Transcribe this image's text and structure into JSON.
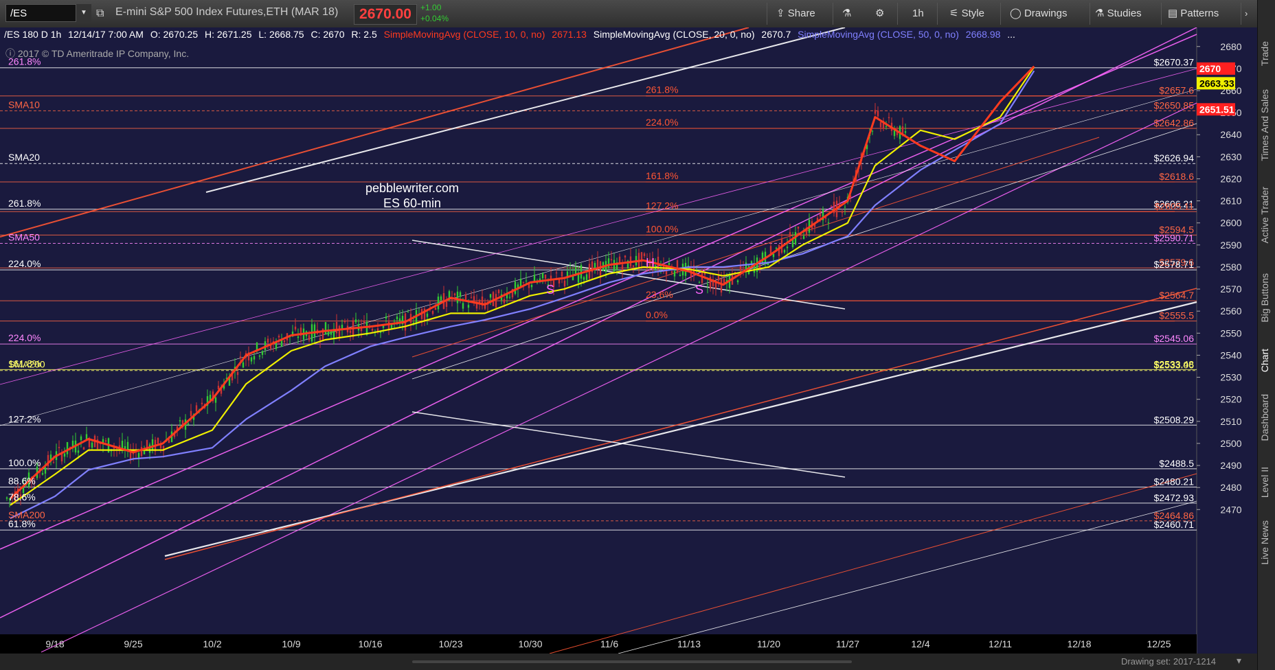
{
  "toolbar": {
    "symbol": "/ES",
    "instrument": "E-mini S&P 500 Index Futures,ETH (MAR 18)",
    "last_price": "2670.00",
    "change": "+1.00",
    "change_pct": "+0.04%",
    "share_label": "Share",
    "timeframe": "1h",
    "style_label": "Style",
    "drawings_label": "Drawings",
    "studies_label": "Studies",
    "patterns_label": "Patterns"
  },
  "infobar": {
    "desc": "/ES 180 D 1h",
    "date": "12/14/17 7:00 AM",
    "open": "O: 2670.25",
    "high": "H: 2671.25",
    "low": "L: 2668.75",
    "close": "C: 2670",
    "range": "R: 2.5",
    "sma10_label": "SimpleMovingAvg (CLOSE, 10, 0, no)",
    "sma10_val": "2671.13",
    "sma20_label": "SimpleMovingAvg (CLOSE, 20, 0, no)",
    "sma20_val": "2670.7",
    "sma50_label": "SimpleMovingAvg (CLOSE, 50, 0, no)",
    "sma50_val": "2668.98",
    "more": "..."
  },
  "copyright": "2017 © TD Ameritrade IP Company, Inc.",
  "side_tabs": [
    "Trade",
    "Times And Sales",
    "Active Trader",
    "Big Buttons",
    "Chart",
    "Dashboard",
    "Level II",
    "Live News"
  ],
  "status": {
    "drawing_set": "Drawing set: 2017-1214"
  },
  "watermark": [
    "pebblewriter.com",
    "ES 60-min"
  ],
  "colors": {
    "background": "#1a1a3e",
    "sma10": "#ff3b1f",
    "sma20": "#f0f000",
    "sma50": "#8080ff",
    "fib_red": "#ff5533",
    "fib_magenta": "#ff66ff",
    "price_up": "#33cc33",
    "price_down": "#cc3333"
  },
  "chart_data": {
    "type": "line",
    "title": "/ES 180 D 1h",
    "ylim": [
      2457,
      2686
    ],
    "y_ticks": [
      2470,
      2480,
      2490,
      2500,
      2510,
      2520,
      2530,
      2540,
      2550,
      2560,
      2570,
      2580,
      2590,
      2600,
      2610,
      2620,
      2630,
      2640,
      2650,
      2660,
      2670,
      2680
    ],
    "x_ticks": [
      "9/18",
      "9/25",
      "10/2",
      "10/9",
      "10/16",
      "10/23",
      "10/30",
      "11/6",
      "11/13",
      "11/20",
      "11/27",
      "12/4",
      "12/11",
      "12/18",
      "12/25"
    ],
    "series": [
      {
        "name": "SimpleMovingAvg (CLOSE, 10, 0, no)",
        "x": [
          "9/14",
          "9/18",
          "9/21",
          "9/25",
          "9/28",
          "10/2",
          "10/5",
          "10/9",
          "10/12",
          "10/16",
          "10/19",
          "10/23",
          "10/26",
          "10/30",
          "11/2",
          "11/6",
          "11/9",
          "11/13",
          "11/16",
          "11/20",
          "11/23",
          "11/27",
          "11/30",
          "12/4",
          "12/7",
          "12/11",
          "12/14"
        ],
        "values": [
          2475,
          2494,
          2502,
          2496,
          2500,
          2520,
          2540,
          2549,
          2551,
          2553,
          2555,
          2566,
          2563,
          2573,
          2575,
          2581,
          2583,
          2578,
          2572,
          2585,
          2596,
          2610,
          2648,
          2635,
          2628,
          2655,
          2671
        ]
      },
      {
        "name": "SimpleMovingAvg (CLOSE, 20, 0, no)",
        "x": [
          "9/14",
          "9/18",
          "9/21",
          "9/25",
          "9/28",
          "10/2",
          "10/5",
          "10/9",
          "10/12",
          "10/16",
          "10/19",
          "10/23",
          "10/26",
          "10/30",
          "11/2",
          "11/6",
          "11/9",
          "11/13",
          "11/16",
          "11/20",
          "11/23",
          "11/27",
          "11/30",
          "12/4",
          "12/7",
          "12/11",
          "12/14"
        ],
        "values": [
          2472,
          2486,
          2497,
          2497,
          2497,
          2506,
          2527,
          2542,
          2547,
          2550,
          2553,
          2559,
          2559,
          2567,
          2570,
          2577,
          2580,
          2579,
          2576,
          2580,
          2590,
          2600,
          2626,
          2642,
          2638,
          2648,
          2670.7
        ]
      },
      {
        "name": "SimpleMovingAvg (CLOSE, 50, 0, no)",
        "x": [
          "9/14",
          "9/18",
          "9/21",
          "9/25",
          "9/28",
          "10/2",
          "10/5",
          "10/9",
          "10/12",
          "10/16",
          "10/19",
          "10/23",
          "10/26",
          "10/30",
          "11/2",
          "11/6",
          "11/9",
          "11/13",
          "11/16",
          "11/20",
          "11/23",
          "11/27",
          "11/30",
          "12/4",
          "12/7",
          "12/11",
          "12/14"
        ],
        "values": [
          2466,
          2476,
          2488,
          2493,
          2494,
          2498,
          2511,
          2524,
          2535,
          2544,
          2548,
          2553,
          2556,
          2561,
          2566,
          2573,
          2577,
          2580,
          2580,
          2582,
          2586,
          2594,
          2608,
          2624,
          2633,
          2645,
          2668.98
        ]
      }
    ],
    "price_labels": [
      {
        "text": "$2670.37",
        "value": 2670.37,
        "color": "#ffffff"
      },
      {
        "text": "$2657.6",
        "value": 2657.6,
        "color": "#ff6644"
      },
      {
        "text": "$2650.85",
        "value": 2650.85,
        "color": "#ff6644"
      },
      {
        "text": "$2642.86",
        "value": 2642.86,
        "color": "#ff6644"
      },
      {
        "text": "$2626.94",
        "value": 2626.94,
        "color": "#ffffff"
      },
      {
        "text": "$2618.6",
        "value": 2618.6,
        "color": "#ff6644"
      },
      {
        "text": "$2606.21",
        "value": 2606.21,
        "color": "#ffffff"
      },
      {
        "text": "$2605.11",
        "value": 2605.11,
        "color": "#ff6644"
      },
      {
        "text": "$2594.5",
        "value": 2594.5,
        "color": "#ff6644"
      },
      {
        "text": "$2590.71",
        "value": 2590.71,
        "color": "#ff88ff"
      },
      {
        "text": "$2579.6",
        "value": 2579.6,
        "color": "#ff6644"
      },
      {
        "text": "$2578.71",
        "value": 2578.71,
        "color": "#ffffff"
      },
      {
        "text": "$2564.7",
        "value": 2564.7,
        "color": "#ff6644"
      },
      {
        "text": "$2555.5",
        "value": 2555.5,
        "color": "#ff6644"
      },
      {
        "text": "$2545.06",
        "value": 2545.06,
        "color": "#ff88ff"
      },
      {
        "text": "$2533.48",
        "value": 2533.48,
        "color": "#ffff66"
      },
      {
        "text": "$2533.06",
        "value": 2533.06,
        "color": "#ffff66"
      },
      {
        "text": "$2508.29",
        "value": 2508.29,
        "color": "#ffffff"
      },
      {
        "text": "$2488.5",
        "value": 2488.5,
        "color": "#ffffff"
      },
      {
        "text": "$2480.21",
        "value": 2480.21,
        "color": "#ffffff"
      },
      {
        "text": "$2472.93",
        "value": 2472.93,
        "color": "#ffffff"
      },
      {
        "text": "$2464.86",
        "value": 2464.86,
        "color": "#ff6644"
      },
      {
        "text": "$2460.71",
        "value": 2460.71,
        "color": "#ffffff"
      }
    ],
    "left_labels": [
      {
        "text": "261.8%",
        "value": 2670.37,
        "color": "#ff88ff"
      },
      {
        "text": "SMA10",
        "value": 2650.85,
        "color": "#ff6644"
      },
      {
        "text": "SMA20",
        "value": 2626.94,
        "color": "#ffffff"
      },
      {
        "text": "261.8%",
        "value": 2606.21,
        "color": "#ffffff"
      },
      {
        "text": "SMA50",
        "value": 2590.71,
        "color": "#ff88ff"
      },
      {
        "text": "224.0%",
        "value": 2578.71,
        "color": "#ffffff"
      },
      {
        "text": "224.0%",
        "value": 2545.06,
        "color": "#ff88ff"
      },
      {
        "text": "161.8%",
        "value": 2533.48,
        "color": "#ffff66"
      },
      {
        "text": "SMA200",
        "value": 2533.06,
        "color": "#ffff66"
      },
      {
        "text": "127.2%",
        "value": 2508.29,
        "color": "#ffffff"
      },
      {
        "text": "100.0%",
        "value": 2488.5,
        "color": "#ffffff"
      },
      {
        "text": "88.6%",
        "value": 2480.21,
        "color": "#ffffff"
      },
      {
        "text": "78.6%",
        "value": 2472.93,
        "color": "#ffffff"
      },
      {
        "text": "SMA200",
        "value": 2464.86,
        "color": "#ff6644"
      },
      {
        "text": "61.8%",
        "value": 2460.71,
        "color": "#ffffff"
      }
    ],
    "fib_labels": [
      {
        "text": "261.8%",
        "value": 2657.6
      },
      {
        "text": "224.0%",
        "value": 2642.86
      },
      {
        "text": "161.8%",
        "value": 2618.6
      },
      {
        "text": "127.2%",
        "value": 2605.11
      },
      {
        "text": "100.0%",
        "value": 2594.5
      },
      {
        "text": "23.6%",
        "value": 2564.7
      },
      {
        "text": "0.0%",
        "value": 2555.5
      }
    ],
    "pattern_labels": [
      "S",
      "H",
      "S"
    ],
    "current_tags": [
      {
        "text": "2670",
        "value": 2670,
        "bg": "#ff2020",
        "fg": "#ffffff"
      },
      {
        "text": "2663.33",
        "value": 2663.33,
        "bg": "#f0f000",
        "fg": "#000000"
      },
      {
        "text": "2651.51",
        "value": 2651.51,
        "bg": "#ff2020",
        "fg": "#ffffff"
      }
    ]
  }
}
